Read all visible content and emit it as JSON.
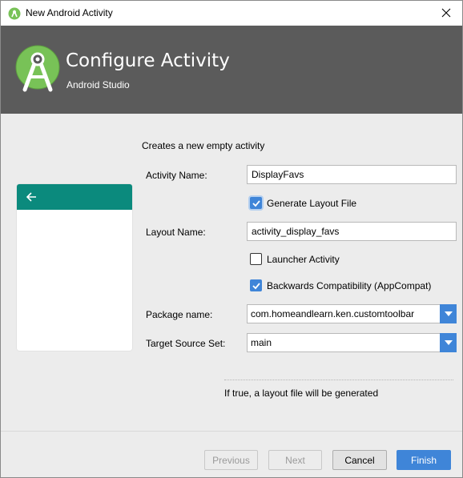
{
  "window": {
    "title": "New Android Activity",
    "close_icon": "close-icon"
  },
  "banner": {
    "heading": "Configure Activity",
    "subheading": "Android Studio",
    "logo_icon": "android-studio-logo-icon"
  },
  "form": {
    "description": "Creates a new empty activity",
    "activity_name_label": "Activity Name:",
    "activity_name_value": "DisplayFavs",
    "generate_layout_label": "Generate Layout File",
    "generate_layout_checked": true,
    "layout_name_label": "Layout Name:",
    "layout_name_value": "activity_display_favs",
    "launcher_activity_label": "Launcher Activity",
    "launcher_activity_checked": false,
    "backwards_compat_label": "Backwards Compatibility (AppCompat)",
    "backwards_compat_checked": true,
    "package_name_label": "Package name:",
    "package_name_value": "com.homeandlearn.ken.customtoolbar",
    "target_source_set_label": "Target Source Set:",
    "target_source_set_value": "main",
    "hint": "If true, a layout file will be generated"
  },
  "preview": {
    "toolbar_color": "#0b8a7d",
    "back_icon": "arrow-left-icon"
  },
  "buttons": {
    "previous": "Previous",
    "next": "Next",
    "cancel": "Cancel",
    "finish": "Finish"
  },
  "colors": {
    "accent": "#3f85d8",
    "banner": "#5b5b5b"
  }
}
